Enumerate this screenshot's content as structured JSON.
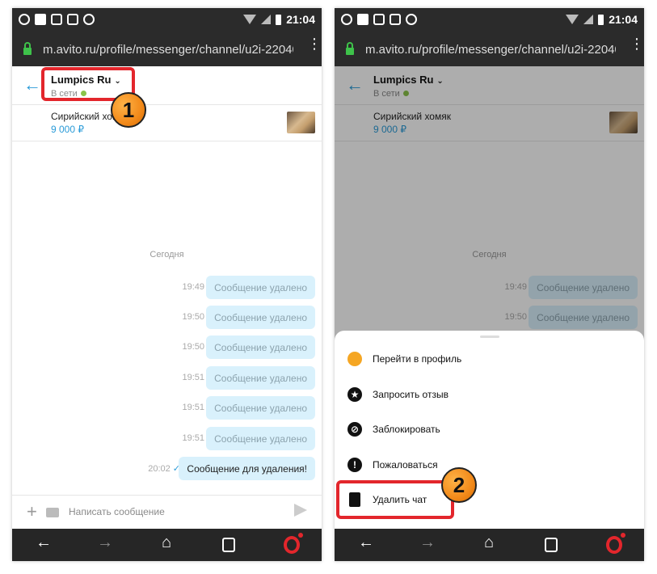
{
  "status_bar": {
    "time": "21:04"
  },
  "browser": {
    "url": "m.avito.ru/profile/messenger/channel/u2i-220401…"
  },
  "chat": {
    "contact_name": "Lumpics Ru",
    "status": "В сети",
    "item_title": "Сирийский хомяк",
    "item_price": "9 000 ₽",
    "day_separator": "Сегодня",
    "messages": [
      {
        "time": "19:49",
        "text": "Сообщение удалено"
      },
      {
        "time": "19:50",
        "text": "Сообщение удалено"
      },
      {
        "time": "19:50",
        "text": "Сообщение удалено"
      },
      {
        "time": "19:51",
        "text": "Сообщение удалено"
      },
      {
        "time": "19:51",
        "text": "Сообщение удалено"
      },
      {
        "time": "19:51",
        "text": "Сообщение удалено"
      },
      {
        "time": "20:02",
        "text": "Сообщение для удаления!"
      }
    ],
    "input_placeholder": "Написать сообщение"
  },
  "menu": {
    "items": [
      {
        "label": "Перейти в профиль",
        "icon": "profile-icon"
      },
      {
        "label": "Запросить отзыв",
        "icon": "star-icon"
      },
      {
        "label": "Заблокировать",
        "icon": "block-user-icon"
      },
      {
        "label": "Пожаловаться",
        "icon": "warning-icon"
      },
      {
        "label": "Удалить чат",
        "icon": "trash-icon"
      }
    ]
  },
  "annotations": {
    "step1": "1",
    "step2": "2",
    "highlight_color": "#e3262c"
  },
  "colors": {
    "accent": "#2a9bd8",
    "bubble": "#d9f1fc",
    "badge": "#f28a1a"
  }
}
